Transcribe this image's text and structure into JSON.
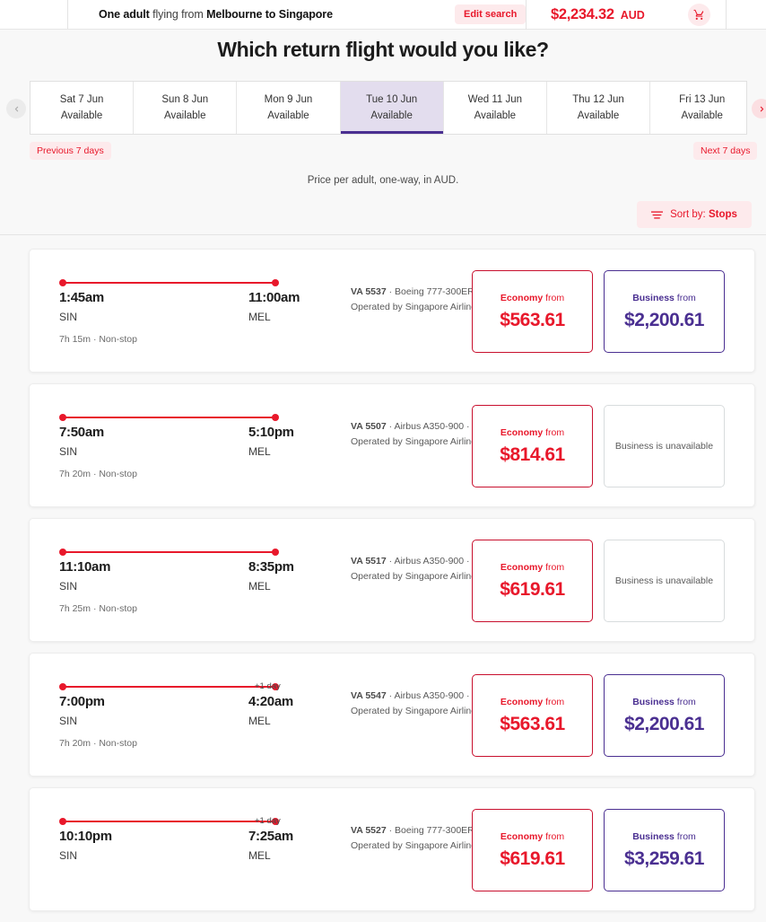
{
  "header": {
    "trip_prefix": "One adult",
    "trip_mid": " flying from ",
    "trip_route": "Melbourne to Singapore",
    "edit_search_label": "Edit search",
    "total_price": "$2,234.32",
    "currency": "AUD",
    "cart_icon": "shopping-cart-icon"
  },
  "page_title": "Which return flight would you like?",
  "date_strip": {
    "prev_arrow_icon": "chevron-left-icon",
    "next_arrow_icon": "chevron-right-icon",
    "days": [
      {
        "date": "Sat 7 Jun",
        "status": "Available",
        "active": false
      },
      {
        "date": "Sun 8 Jun",
        "status": "Available",
        "active": false
      },
      {
        "date": "Mon 9 Jun",
        "status": "Available",
        "active": false
      },
      {
        "date": "Tue 10 Jun",
        "status": "Available",
        "active": true
      },
      {
        "date": "Wed 11 Jun",
        "status": "Available",
        "active": false
      },
      {
        "date": "Thu 12 Jun",
        "status": "Available",
        "active": false
      },
      {
        "date": "Fri 13 Jun",
        "status": "Available",
        "active": false
      }
    ],
    "prev_pill": "Previous 7 days",
    "next_pill": "Next 7 days"
  },
  "price_note": "Price per adult, one-way, in AUD.",
  "sort": {
    "icon": "sort-lines-icon",
    "prefix": "Sort by: ",
    "value": "Stops"
  },
  "colors": {
    "accent_red": "#e8182b",
    "economy_border": "#c8102e",
    "business_purple": "#4a2f91",
    "active_tab_bg": "#e3ddee",
    "pill_bg": "#fdeaec",
    "page_bg": "#f8f8f8"
  },
  "flights": [
    {
      "depart_time": "1:45am",
      "depart_code": "SIN",
      "arrive_time": "11:00am",
      "arrive_code": "MEL",
      "plus_day": "",
      "duration": "7h 15m · Non-stop",
      "flight_no": "VA 5537",
      "aircraft": " · Boeing 777-300ER ·",
      "operator": "Operated by Singapore Airlines",
      "economy_label": "Economy",
      "economy_from": " from",
      "economy_price": "$563.61",
      "business_available": true,
      "business_label": "Business",
      "business_from": " from",
      "business_price": "$2,200.61",
      "business_unavailable_text": ""
    },
    {
      "depart_time": "7:50am",
      "depart_code": "SIN",
      "arrive_time": "5:10pm",
      "arrive_code": "MEL",
      "plus_day": "",
      "duration": "7h 20m · Non-stop",
      "flight_no": "VA 5507",
      "aircraft": " · Airbus A350-900 ·",
      "operator": "Operated by Singapore Airlines",
      "economy_label": "Economy",
      "economy_from": " from",
      "economy_price": "$814.61",
      "business_available": false,
      "business_label": "",
      "business_from": "",
      "business_price": "",
      "business_unavailable_text": "Business is unavailable"
    },
    {
      "depart_time": "11:10am",
      "depart_code": "SIN",
      "arrive_time": "8:35pm",
      "arrive_code": "MEL",
      "plus_day": "",
      "duration": "7h 25m · Non-stop",
      "flight_no": "VA 5517",
      "aircraft": " · Airbus A350-900 ·",
      "operator": "Operated by Singapore Airlines",
      "economy_label": "Economy",
      "economy_from": " from",
      "economy_price": "$619.61",
      "business_available": false,
      "business_label": "",
      "business_from": "",
      "business_price": "",
      "business_unavailable_text": "Business is unavailable"
    },
    {
      "depart_time": "7:00pm",
      "depart_code": "SIN",
      "arrive_time": "4:20am",
      "arrive_code": "MEL",
      "plus_day": "+1 day",
      "duration": "7h 20m · Non-stop",
      "flight_no": "VA 5547",
      "aircraft": " · Airbus A350-900 ·",
      "operator": "Operated by Singapore Airlines",
      "economy_label": "Economy",
      "economy_from": " from",
      "economy_price": "$563.61",
      "business_available": true,
      "business_label": "Business",
      "business_from": " from",
      "business_price": "$2,200.61",
      "business_unavailable_text": ""
    },
    {
      "depart_time": "10:10pm",
      "depart_code": "SIN",
      "arrive_time": "7:25am",
      "arrive_code": "MEL",
      "plus_day": "+1 day",
      "duration": "",
      "flight_no": "VA 5527",
      "aircraft": " · Boeing 777-300ER ·",
      "operator": "Operated by Singapore Airlines",
      "economy_label": "Economy",
      "economy_from": " from",
      "economy_price": "$619.61",
      "business_available": true,
      "business_label": "Business",
      "business_from": " from",
      "business_price": "$3,259.61",
      "business_unavailable_text": ""
    }
  ]
}
